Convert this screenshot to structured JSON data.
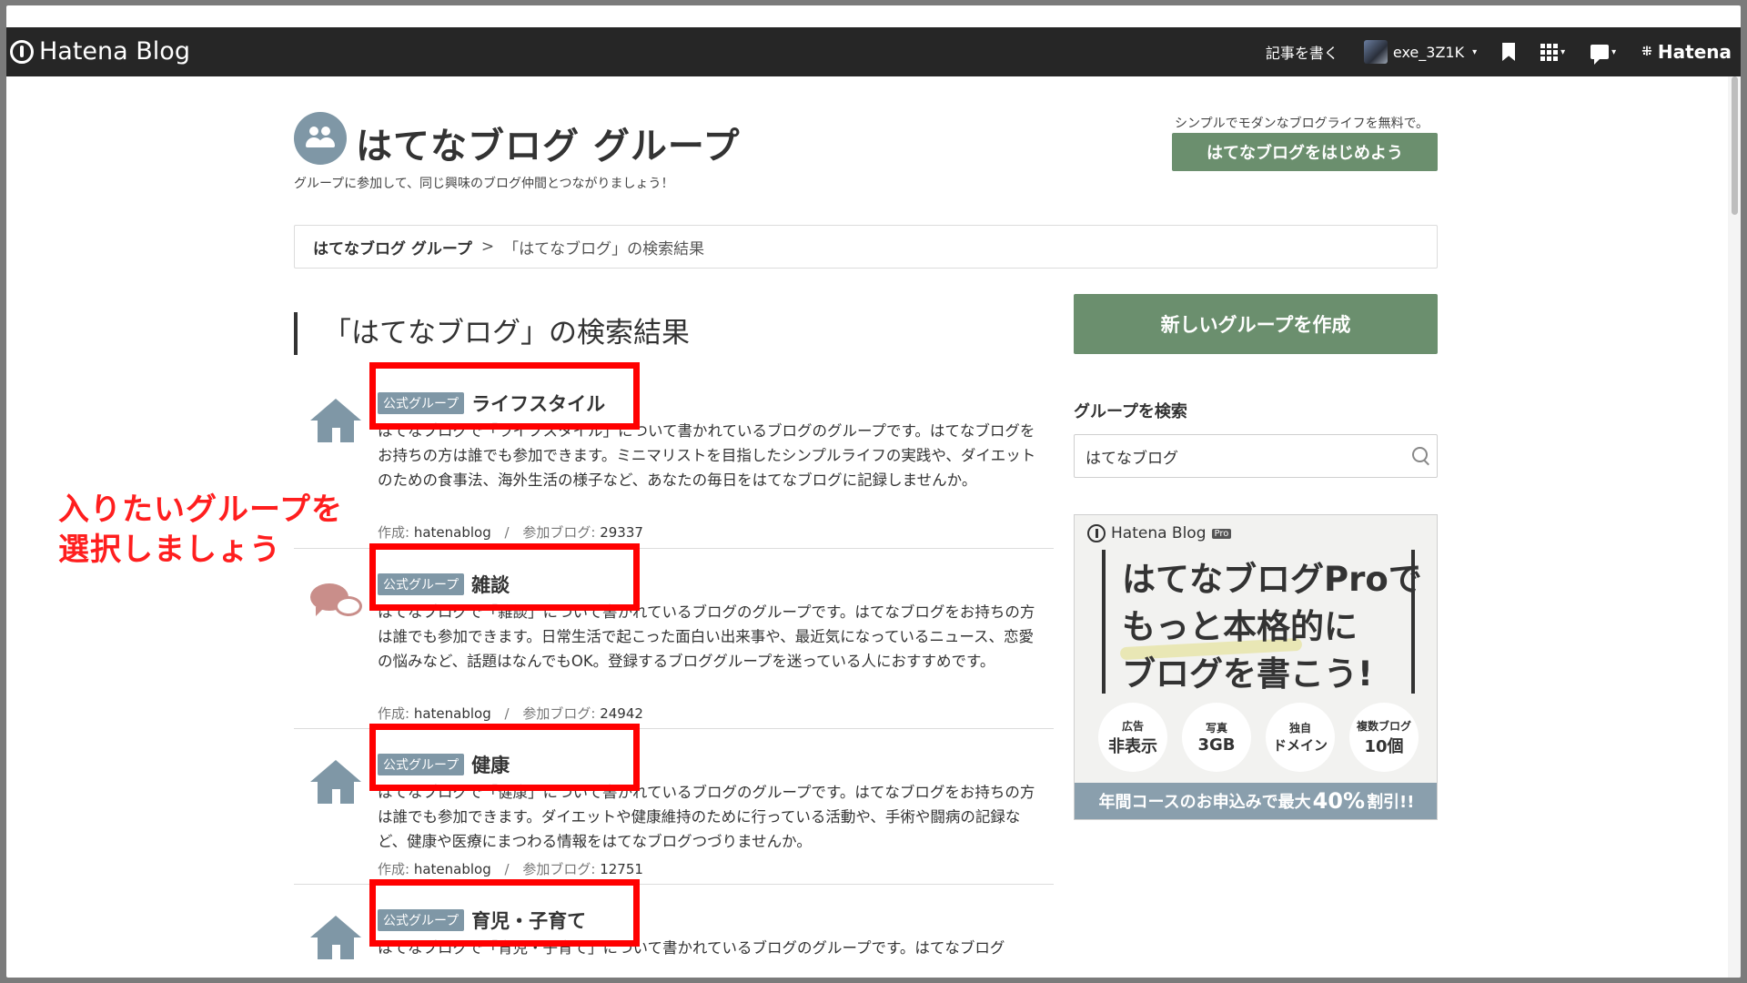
{
  "topbar": {
    "logo_text": "Hatena Blog",
    "write_label": "記事を書く",
    "username": "exe_3Z1K",
    "hatena_label": "Hatena"
  },
  "header": {
    "title": "はてなブログ グループ",
    "subtitle": "グループに参加して、同じ興味のブログ仲間とつながりましょう！",
    "promo_text": "シンプルでモダンなブログライフを無料で。",
    "promo_button": "はてなブログをはじめよう"
  },
  "breadcrumb": {
    "root": "はてなブログ グループ",
    "separator": ">",
    "current": "「はてなブログ」の検索結果"
  },
  "main": {
    "heading": "「はてなブログ」の検索結果",
    "groups": [
      {
        "badge": "公式グループ",
        "name": "ライフスタイル",
        "icon": "house-icon",
        "description": "はてなブログで「ライフスタイル」について書かれているブログのグループです。はてなブログをお持ちの方は誰でも参加できます。ミニマリストを目指したシンプルライフの実践や、ダイエットのための食事法、海外生活の様子など、あなたの毎日をはてなブログに記録しませんか。",
        "creator_label": "作成:",
        "creator": "hatenablog",
        "blogs_label": "参加ブログ:",
        "blogs": "29337"
      },
      {
        "badge": "公式グループ",
        "name": "雑談",
        "icon": "chat-bubbles-icon",
        "description": "はてなブログで「雑談」について書かれているブログのグループです。はてなブログをお持ちの方は誰でも参加できます。日常生活で起こった面白い出来事や、最近気になっているニュース、恋愛の悩みなど、話題はなんでもOK。登録するブロググループを迷っている人におすすめです。",
        "creator_label": "作成:",
        "creator": "hatenablog",
        "blogs_label": "参加ブログ:",
        "blogs": "24942"
      },
      {
        "badge": "公式グループ",
        "name": "健康",
        "icon": "house-icon",
        "description": "はてなブログで「健康」について書かれているブログのグループです。はてなブログをお持ちの方は誰でも参加できます。ダイエットや健康維持のために行っている活動や、手術や闘病の記録など、健康や医療にまつわる情報をはてなブログつづりませんか。",
        "creator_label": "作成:",
        "creator": "hatenablog",
        "blogs_label": "参加ブログ:",
        "blogs": "12751"
      },
      {
        "badge": "公式グループ",
        "name": "育児・子育て",
        "icon": "house-icon",
        "description": "はてなブログで「育児・子育て」について書かれているブログのグループです。はてなブログ",
        "creator_label": "",
        "creator": "",
        "blogs_label": "",
        "blogs": ""
      }
    ]
  },
  "annotation": {
    "line1": "入りたいグループを",
    "line2": "選択しましょう"
  },
  "sidebar": {
    "new_group_button": "新しいグループを作成",
    "search_label": "グループを検索",
    "search_value": "はてなブログ",
    "ad": {
      "logo": "Hatena Blog",
      "pro_badge": "Pro",
      "line1": "はてなブログProで",
      "line2": "もっと本格的に",
      "line3": "ブログを書こう!",
      "features": [
        {
          "small": "広告",
          "large": "非表示"
        },
        {
          "small": "写真",
          "large": "3GB"
        },
        {
          "small": "独自",
          "large": "ドメイン"
        },
        {
          "small": "複数ブログ",
          "large": "10個"
        }
      ],
      "footer_pre": "年間コースのお申込みで最大",
      "footer_pct": "40%",
      "footer_post": "割引!!"
    }
  },
  "colors": {
    "topbar": "#262626",
    "accent_green": "#6b8f6e",
    "badge_blue": "#7f97a6",
    "annotation_red": "#ff1e1e"
  }
}
